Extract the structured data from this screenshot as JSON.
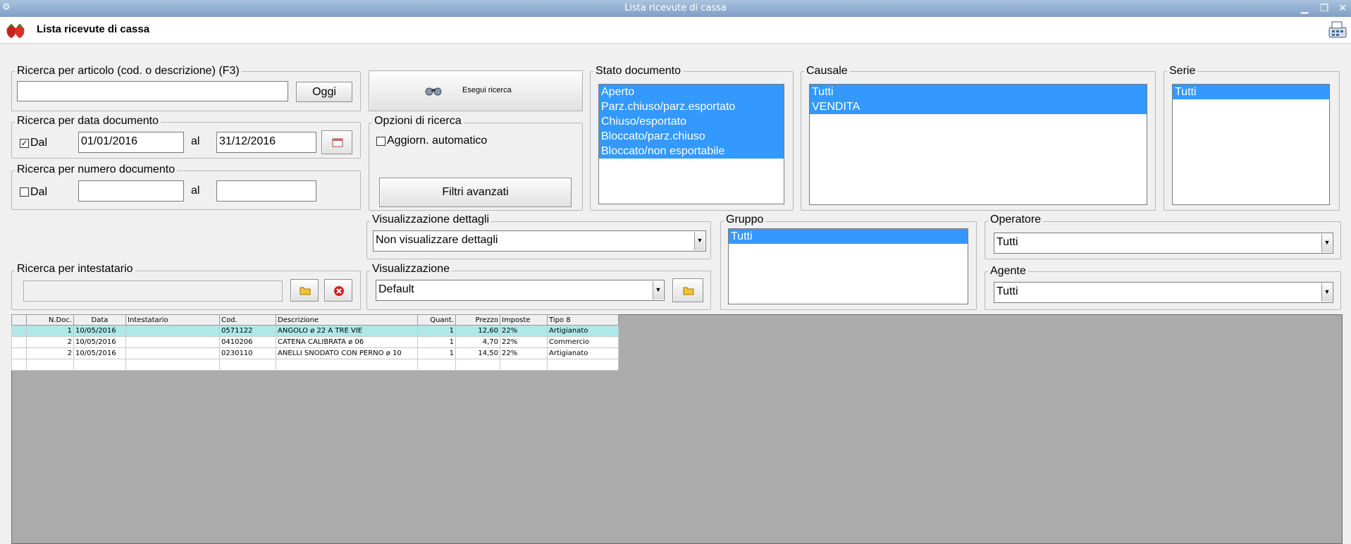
{
  "window": {
    "title": "Lista ricevute di cassa"
  },
  "app": {
    "title": "Lista ricevute di cassa"
  },
  "articolo": {
    "legend": "Ricerca per articolo (cod. o descrizione) (F3)",
    "value": "",
    "btn_oggi": "Oggi"
  },
  "esegui": {
    "label": "Esegui ricerca"
  },
  "data_doc": {
    "legend": "Ricerca per data documento",
    "chk_label": "Dal",
    "checked": true,
    "from": "01/01/2016",
    "to_label": "al",
    "to": "31/12/2016"
  },
  "num_doc": {
    "legend": "Ricerca per numero documento",
    "chk_label": "Dal",
    "checked": false,
    "from": "",
    "to_label": "al",
    "to": ""
  },
  "opzioni": {
    "legend": "Opzioni di ricerca",
    "aggiorn_label": "Aggiorn. automatico",
    "filtri_label": "Filtri avanzati"
  },
  "stato": {
    "legend": "Stato documento",
    "items": [
      "Aperto",
      "Parz.chiuso/parz.esportato",
      "Chiuso/esportato",
      "Bloccato/parz.chiuso",
      "Bloccato/non esportabile"
    ]
  },
  "causale": {
    "legend": "Causale",
    "items": [
      "Tutti",
      "VENDITA"
    ]
  },
  "serie": {
    "legend": "Serie",
    "items": [
      "Tutti"
    ]
  },
  "vis_dettagli": {
    "legend": "Visualizzazione dettagli",
    "value": "Non visualizzare dettagli"
  },
  "gruppo": {
    "legend": "Gruppo",
    "items": [
      "Tutti"
    ]
  },
  "operatore": {
    "legend": "Operatore",
    "value": "Tutti"
  },
  "intestatario": {
    "legend": "Ricerca per intestatario",
    "value": ""
  },
  "visualizzazione": {
    "legend": "Visualizzazione",
    "value": "Default"
  },
  "agente": {
    "legend": "Agente",
    "value": "Tutti"
  },
  "grid": {
    "columns": [
      "",
      "N.Doc.",
      "Data",
      "Intestatario",
      "Cod.",
      "Descrizione",
      "Quant.",
      "Prezzo",
      "Imposte",
      "Tipo 8"
    ],
    "rows": [
      [
        "",
        "1",
        "10/05/2016",
        "",
        "0571122",
        "ANGOLO  ø 22 A TRE VIE",
        "1",
        "12,60",
        "22%",
        "Artigianato"
      ],
      [
        "",
        "2",
        "10/05/2016",
        "",
        "0410206",
        "CATENA CALIBRATA ø 06",
        "1",
        "4,70",
        "22%",
        "Commercio"
      ],
      [
        "",
        "2",
        "10/05/2016",
        "",
        "0230110",
        "ANELLI SNODATO CON PERNO ø 10",
        "1",
        "14,50",
        "22%",
        "Artigianato"
      ]
    ]
  },
  "colors": {
    "selection": "#3399ff",
    "highlight_row": "#aee8e8",
    "grid_bg": "#ababab"
  }
}
